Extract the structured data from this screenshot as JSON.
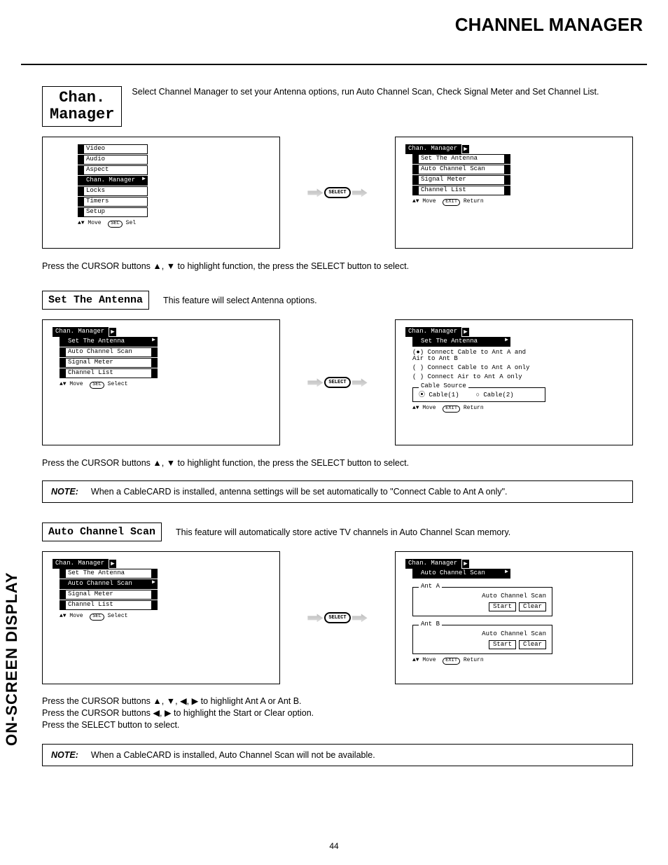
{
  "header": {
    "title": "CHANNEL MANAGER"
  },
  "sidebar": {
    "label": "ON-SCREEN DISPLAY"
  },
  "intro": {
    "label_l1": "Chan.",
    "label_l2": "Manager",
    "text": "Select Channel Manager to set your Antenna options, run Auto Channel Scan, Check Signal Meter and Set Channel List."
  },
  "osd_main": {
    "left": {
      "items": [
        "Video",
        "Audio",
        "Aspect",
        "Chan. Manager",
        "Locks",
        "Timers",
        "Setup"
      ],
      "selected_idx": 3,
      "footer_move": "Move",
      "footer_sel_btn": "SEL",
      "footer_sel": "Sel"
    },
    "right": {
      "header": "Chan. Manager",
      "items": [
        "Set The Antenna",
        "Auto Channel Scan",
        "Signal Meter",
        "Channel List"
      ],
      "footer_move": "Move",
      "footer_ret_btn": "EXIT",
      "footer_ret": "Return"
    },
    "pill": "SELECT"
  },
  "instr1": "Press the CURSOR buttons ▲, ▼ to highlight function, the press the SELECT button to select.",
  "set_antenna": {
    "label": "Set The Antenna",
    "desc": "This feature will select Antenna options.",
    "left": {
      "header": "Chan. Manager",
      "items": [
        "Set The Antenna",
        "Auto Channel Scan",
        "Signal Meter",
        "Channel List"
      ],
      "selected_idx": 0,
      "footer_move": "Move",
      "footer_sel_btn": "SEL",
      "footer_sel": "Select"
    },
    "right": {
      "header": "Chan. Manager",
      "sub": "Set The Antenna",
      "opt1": "(●) Connect Cable to Ant A and",
      "opt1b": "    Air to Ant B",
      "opt2": "( ) Connect Cable to Ant A only",
      "opt3": "( ) Connect Air to Ant A only",
      "cable_src": "Cable Source",
      "cable1": "⦿ Cable(1)",
      "cable2": "○ Cable(2)",
      "footer_move": "Move",
      "footer_ret_btn": "EXIT",
      "footer_ret": "Return"
    },
    "pill": "SELECT"
  },
  "instr2": "Press the CURSOR buttons ▲, ▼ to highlight function, the press the SELECT button to select.",
  "note1": {
    "label": "NOTE:",
    "text": "When a CableCARD is installed, antenna settings will be set automatically to \"Connect Cable to Ant A only\"."
  },
  "auto_scan": {
    "label": "Auto Channel Scan",
    "desc": "This feature will automatically store active TV channels in Auto Channel Scan memory.",
    "left": {
      "header": "Chan. Manager",
      "items": [
        "Set The Antenna",
        "Auto Channel Scan",
        "Signal Meter",
        "Channel List"
      ],
      "selected_idx": 1,
      "footer_move": "Move",
      "footer_sel_btn": "SEL",
      "footer_sel": "Select"
    },
    "right": {
      "header": "Chan. Manager",
      "sub": "Auto Channel Scan",
      "antA": "Ant A",
      "antB": "Ant B",
      "line": "Auto Channel Scan",
      "start": "Start",
      "clear": "Clear",
      "footer_move": "Move",
      "footer_ret_btn": "EXIT",
      "footer_ret": "Return"
    },
    "pill": "SELECT"
  },
  "instr3a": "Press the CURSOR buttons ▲, ▼, ◀, ▶ to highlight Ant A or Ant B.",
  "instr3b": "Press the CURSOR buttons ◀, ▶ to highlight the Start or Clear option.",
  "instr3c": "Press the SELECT button to select.",
  "note2": {
    "label": "NOTE:",
    "text": "When a CableCARD is installed, Auto Channel Scan will not be available."
  },
  "page_number": "44"
}
